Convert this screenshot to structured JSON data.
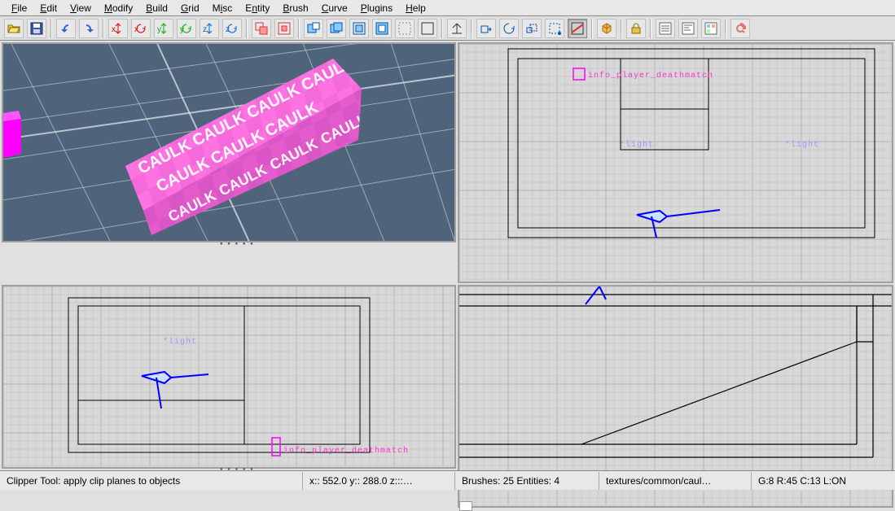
{
  "menu": {
    "items": [
      {
        "label": "File",
        "accel_index": 0
      },
      {
        "label": "Edit",
        "accel_index": 0
      },
      {
        "label": "View",
        "accel_index": 0
      },
      {
        "label": "Modify",
        "accel_index": 0
      },
      {
        "label": "Build",
        "accel_index": 0
      },
      {
        "label": "Grid",
        "accel_index": 0
      },
      {
        "label": "Misc",
        "accel_index": 1
      },
      {
        "label": "Entity",
        "accel_index": 1
      },
      {
        "label": "Brush",
        "accel_index": 0
      },
      {
        "label": "Curve",
        "accel_index": 0
      },
      {
        "label": "Plugins",
        "accel_index": 0
      },
      {
        "label": "Help",
        "accel_index": 0
      }
    ]
  },
  "toolbar": {
    "groups": [
      [
        {
          "name": "open-icon",
          "title": "Open"
        },
        {
          "name": "save-icon",
          "title": "Save"
        }
      ],
      [
        {
          "name": "undo-icon",
          "title": "Undo"
        },
        {
          "name": "redo-icon",
          "title": "Redo"
        }
      ],
      [
        {
          "name": "flipx-icon",
          "title": "Flip X"
        },
        {
          "name": "rotx-icon",
          "title": "Rotate X"
        },
        {
          "name": "flipy-icon",
          "title": "Flip Y"
        },
        {
          "name": "roty-icon",
          "title": "Rotate Y"
        },
        {
          "name": "flipz-icon",
          "title": "Flip Z"
        },
        {
          "name": "rotz-icon",
          "title": "Rotate Z"
        }
      ],
      [
        {
          "name": "sel-touching-icon",
          "title": "Select Touching"
        },
        {
          "name": "sel-inside-icon",
          "title": "Select Inside"
        }
      ],
      [
        {
          "name": "csg-subtract-icon",
          "title": "CSG Subtract"
        },
        {
          "name": "csg-merge-icon",
          "title": "CSG Merge"
        },
        {
          "name": "hollow-icon",
          "title": "Make Hollow"
        },
        {
          "name": "room-icon",
          "title": "Make Room"
        },
        {
          "name": "detail-icon",
          "title": "Make Detail"
        },
        {
          "name": "structural-icon",
          "title": "Make Structural"
        }
      ],
      [
        {
          "name": "camera-icon",
          "title": "Change camera view"
        }
      ],
      [
        {
          "name": "translate-icon",
          "title": "Translate"
        },
        {
          "name": "rotate-icon",
          "title": "Rotate"
        },
        {
          "name": "scale-icon",
          "title": "Scale"
        },
        {
          "name": "resize-icon",
          "title": "Resize"
        },
        {
          "name": "clipper-icon",
          "title": "Clipper",
          "active": true
        }
      ],
      [
        {
          "name": "cubic-clip-icon",
          "title": "Cubic clip"
        }
      ],
      [
        {
          "name": "texture-lock-icon",
          "title": "Texture lock"
        }
      ],
      [
        {
          "name": "entity-list-icon",
          "title": "Entity list"
        },
        {
          "name": "entity-insp-icon",
          "title": "Entity inspector"
        },
        {
          "name": "texture-browser-icon",
          "title": "Texture browser"
        }
      ],
      [
        {
          "name": "refresh-icon",
          "title": "Refresh"
        }
      ]
    ]
  },
  "viewport3d": {
    "caulk_label": "CAULK",
    "caulk_color": "#e060d0",
    "caulk_color2": "#ff77e3",
    "entity_color": "#ff00ff"
  },
  "view_xy": {
    "spawn_label": "info_player_deathmatch",
    "light_label_left": "*light",
    "light_label_right": "*light"
  },
  "view_xz": {
    "spawn_label": "info_player_deathmatch",
    "light_label": "*light"
  },
  "status": {
    "hint": "Clipper Tool: apply clip planes to objects",
    "coords": "x:: 552.0  y:: 288.0  z:::…",
    "counts": "Brushes: 25 Entities: 4",
    "texture": "textures/common/caul…",
    "grid": "G:8  R:45  C:13  L:ON"
  },
  "colors": {
    "player": "#0000ff",
    "spawn": "#ff33cc",
    "light": "#9999ff"
  }
}
